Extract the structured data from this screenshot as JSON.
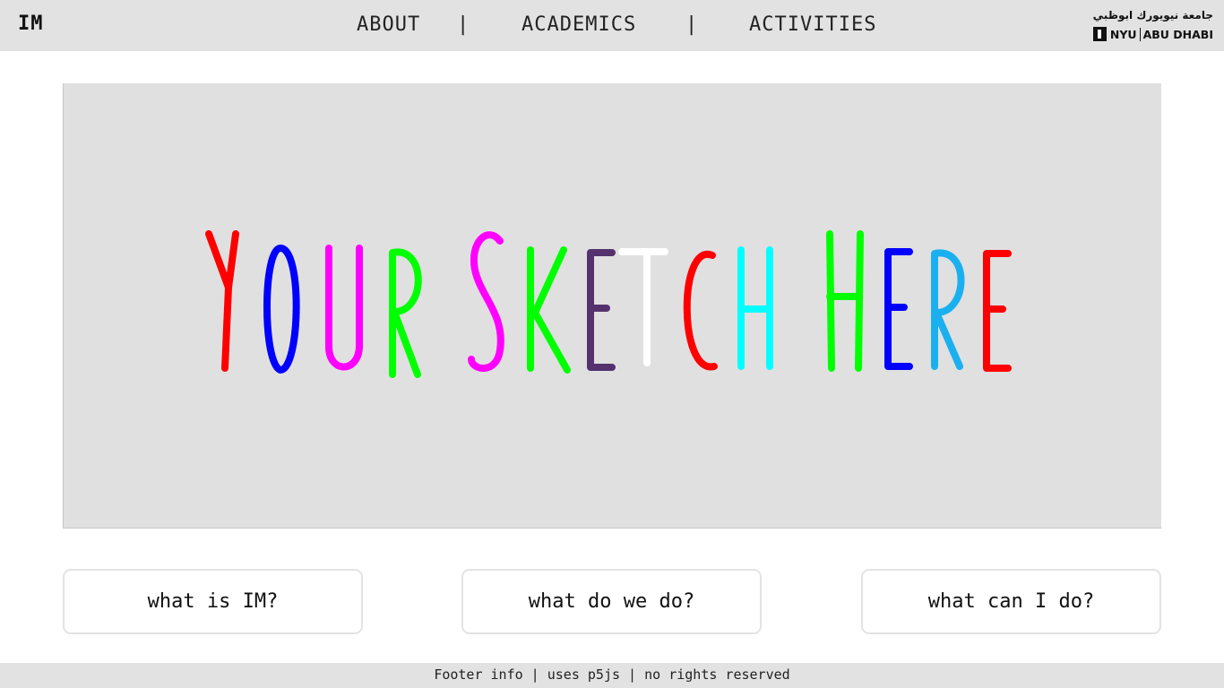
{
  "header": {
    "brand": "IM",
    "nav": [
      {
        "label": "ABOUT"
      },
      {
        "label": "ACADEMICS"
      },
      {
        "label": "ACTIVITIES"
      }
    ],
    "separator": "|",
    "logo": {
      "arabic_text": "جامعة نيويورك ابوظبي",
      "nyu": "NYU",
      "abu_dhabi": "ABU DHABI"
    }
  },
  "sketch": {
    "background": "#e0e0e0",
    "letters": [
      {
        "char": "Y",
        "color": "#ff0000"
      },
      {
        "char": "O",
        "color": "#0000ff"
      },
      {
        "char": "U",
        "color": "#ff00ff"
      },
      {
        "char": "R",
        "color": "#00ff00"
      },
      {
        "char": "S",
        "color": "#ff00ff"
      },
      {
        "char": "K",
        "color": "#00ff00"
      },
      {
        "char": "E",
        "color": "#55326e"
      },
      {
        "char": "T",
        "color": "#ffffff"
      },
      {
        "char": "C",
        "color": "#ff0000"
      },
      {
        "char": "H",
        "color": "#00ffff"
      },
      {
        "char": "H",
        "color": "#00ff00"
      },
      {
        "char": "E",
        "color": "#0000ff"
      },
      {
        "char": "R",
        "color": "#1ab0f0"
      },
      {
        "char": "E",
        "color": "#ff0000"
      }
    ]
  },
  "buttons": [
    {
      "label": "what is IM?"
    },
    {
      "label": "what do we do?"
    },
    {
      "label": "what can I do?"
    }
  ],
  "footer": {
    "text": "Footer info | uses p5js | no rights reserved"
  }
}
